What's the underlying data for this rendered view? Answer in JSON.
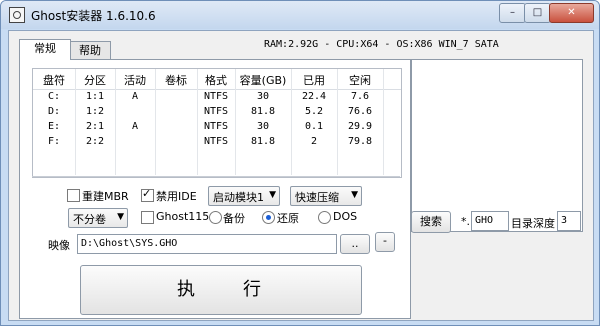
{
  "window": {
    "title": "Ghost安装器 1.6.10.6",
    "controls": {
      "min": "–",
      "max": "□",
      "close": "✕"
    }
  },
  "tabs": [
    {
      "label": "常规"
    },
    {
      "label": "帮助"
    }
  ],
  "system_info": "RAM:2.92G - CPU:X64 - OS:X86 WIN_7 SATA",
  "table": {
    "columns": [
      "盘符",
      "分区",
      "活动",
      "卷标",
      "格式",
      "容量(GB)",
      "已用",
      "空闲"
    ],
    "rows": [
      [
        "C:",
        "1:1",
        "A",
        "",
        "NTFS",
        "30",
        "22.4",
        "7.6"
      ],
      [
        "D:",
        "1:2",
        "",
        "",
        "NTFS",
        "81.8",
        "5.2",
        "76.6"
      ],
      [
        "E:",
        "2:1",
        "A",
        "",
        "NTFS",
        "30",
        "0.1",
        "29.9"
      ],
      [
        "F:",
        "2:2",
        "",
        "",
        "NTFS",
        "81.8",
        "2",
        "79.8"
      ]
    ]
  },
  "options": {
    "rebuild_mbr": {
      "label": "重建MBR",
      "checked": false
    },
    "disable_ide": {
      "label": "禁用IDE",
      "checked": true
    },
    "boot_module": {
      "value": "启动模块1"
    },
    "compression": {
      "value": "快速压缩"
    },
    "split": {
      "value": "不分卷"
    },
    "ghost115": {
      "label": "Ghost115",
      "checked": false
    },
    "mode": {
      "backup": {
        "label": "备份",
        "selected": false
      },
      "restore": {
        "label": "还原",
        "selected": true
      },
      "dos": {
        "label": "DOS",
        "selected": false
      }
    }
  },
  "image": {
    "label": "映像",
    "path": "D:\\Ghost\\SYS.GHO",
    "browse_label": "..",
    "minus_label": "-"
  },
  "execute_label": "执　　行",
  "search": {
    "button_label": "搜索",
    "pattern_prefix": "*.",
    "pattern": "GHO",
    "depth_label": "目录深度",
    "depth_value": "3"
  }
}
